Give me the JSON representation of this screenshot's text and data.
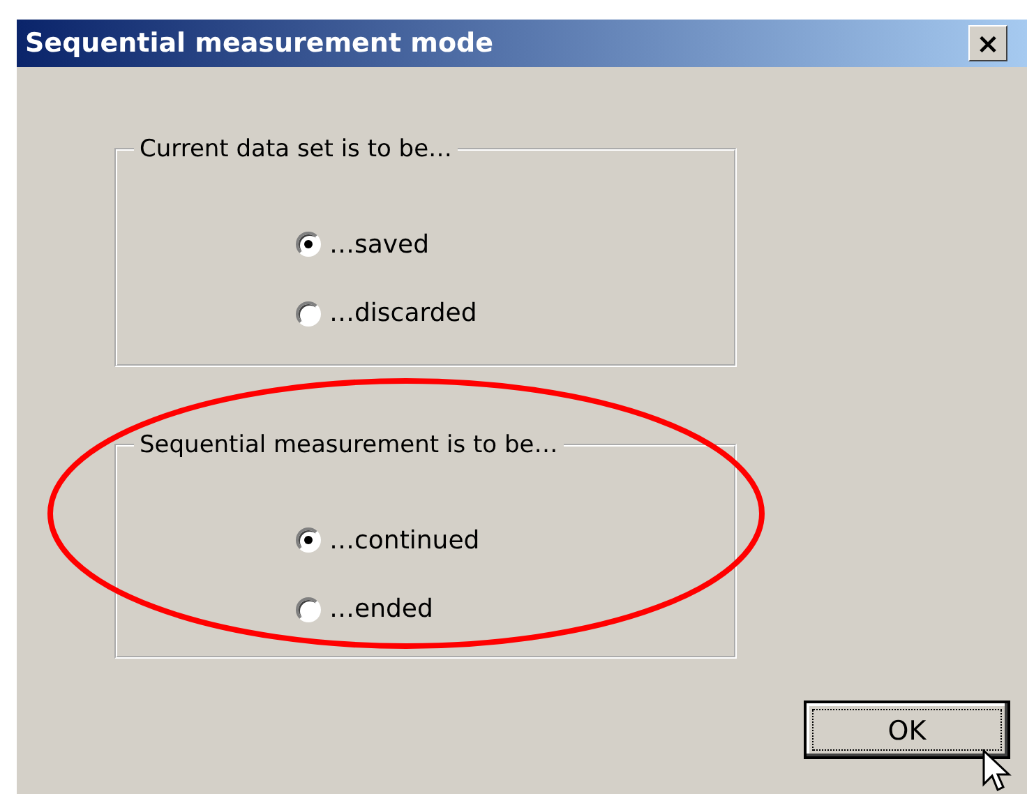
{
  "window": {
    "title": "Sequential measurement mode",
    "close_label": "×"
  },
  "groups": [
    {
      "legend": "Current data set is to be…",
      "options": [
        {
          "label": "…saved",
          "selected": true
        },
        {
          "label": "…discarded",
          "selected": false
        }
      ]
    },
    {
      "legend": "Sequential measurement is to be…",
      "highlighted": true,
      "options": [
        {
          "label": "…continued",
          "selected": true
        },
        {
          "label": "…ended",
          "selected": false
        }
      ]
    }
  ],
  "buttons": [
    {
      "label": "OK",
      "focused": true
    }
  ]
}
